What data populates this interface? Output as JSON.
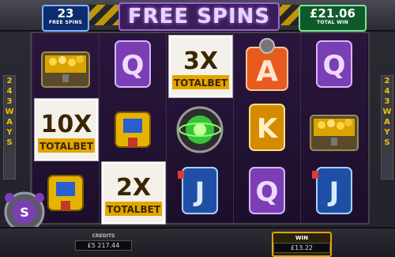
{
  "header": {
    "title": "FREE SPINS",
    "spins_count": "23",
    "spins_label": "FREE SPINS",
    "total_win": "£21.06",
    "total_win_label": "TOTAL WIN"
  },
  "side": {
    "ways_left": [
      "2",
      "4",
      "3",
      "W",
      "A",
      "Y",
      "S"
    ],
    "ways_right": [
      "2",
      "4",
      "3",
      "W",
      "A",
      "Y",
      "S"
    ]
  },
  "reels": [
    [
      "treasure-chest",
      "10x-total-bet",
      "gold-robot"
    ],
    [
      "Q",
      "gold-robot",
      "2x-total-bet"
    ],
    [
      "3x-total-bet",
      "green-orb",
      "J"
    ],
    [
      "A",
      "K",
      "Q"
    ],
    [
      "Q",
      "treasure-chest",
      "J"
    ]
  ],
  "multipliers": {
    "reel1": "10X",
    "reel2": "2X",
    "reel3": "3X",
    "caption": "TOTALBET"
  },
  "footer": {
    "credits_label": "CREDITS",
    "credits_value": "£5 217.44",
    "win_label": "WIN",
    "win_value": "£13.22"
  },
  "colors": {
    "purple": "#9b64d6",
    "gold": "#f2c100",
    "blue": "#0e2d6f",
    "green": "#0f5a2a"
  }
}
